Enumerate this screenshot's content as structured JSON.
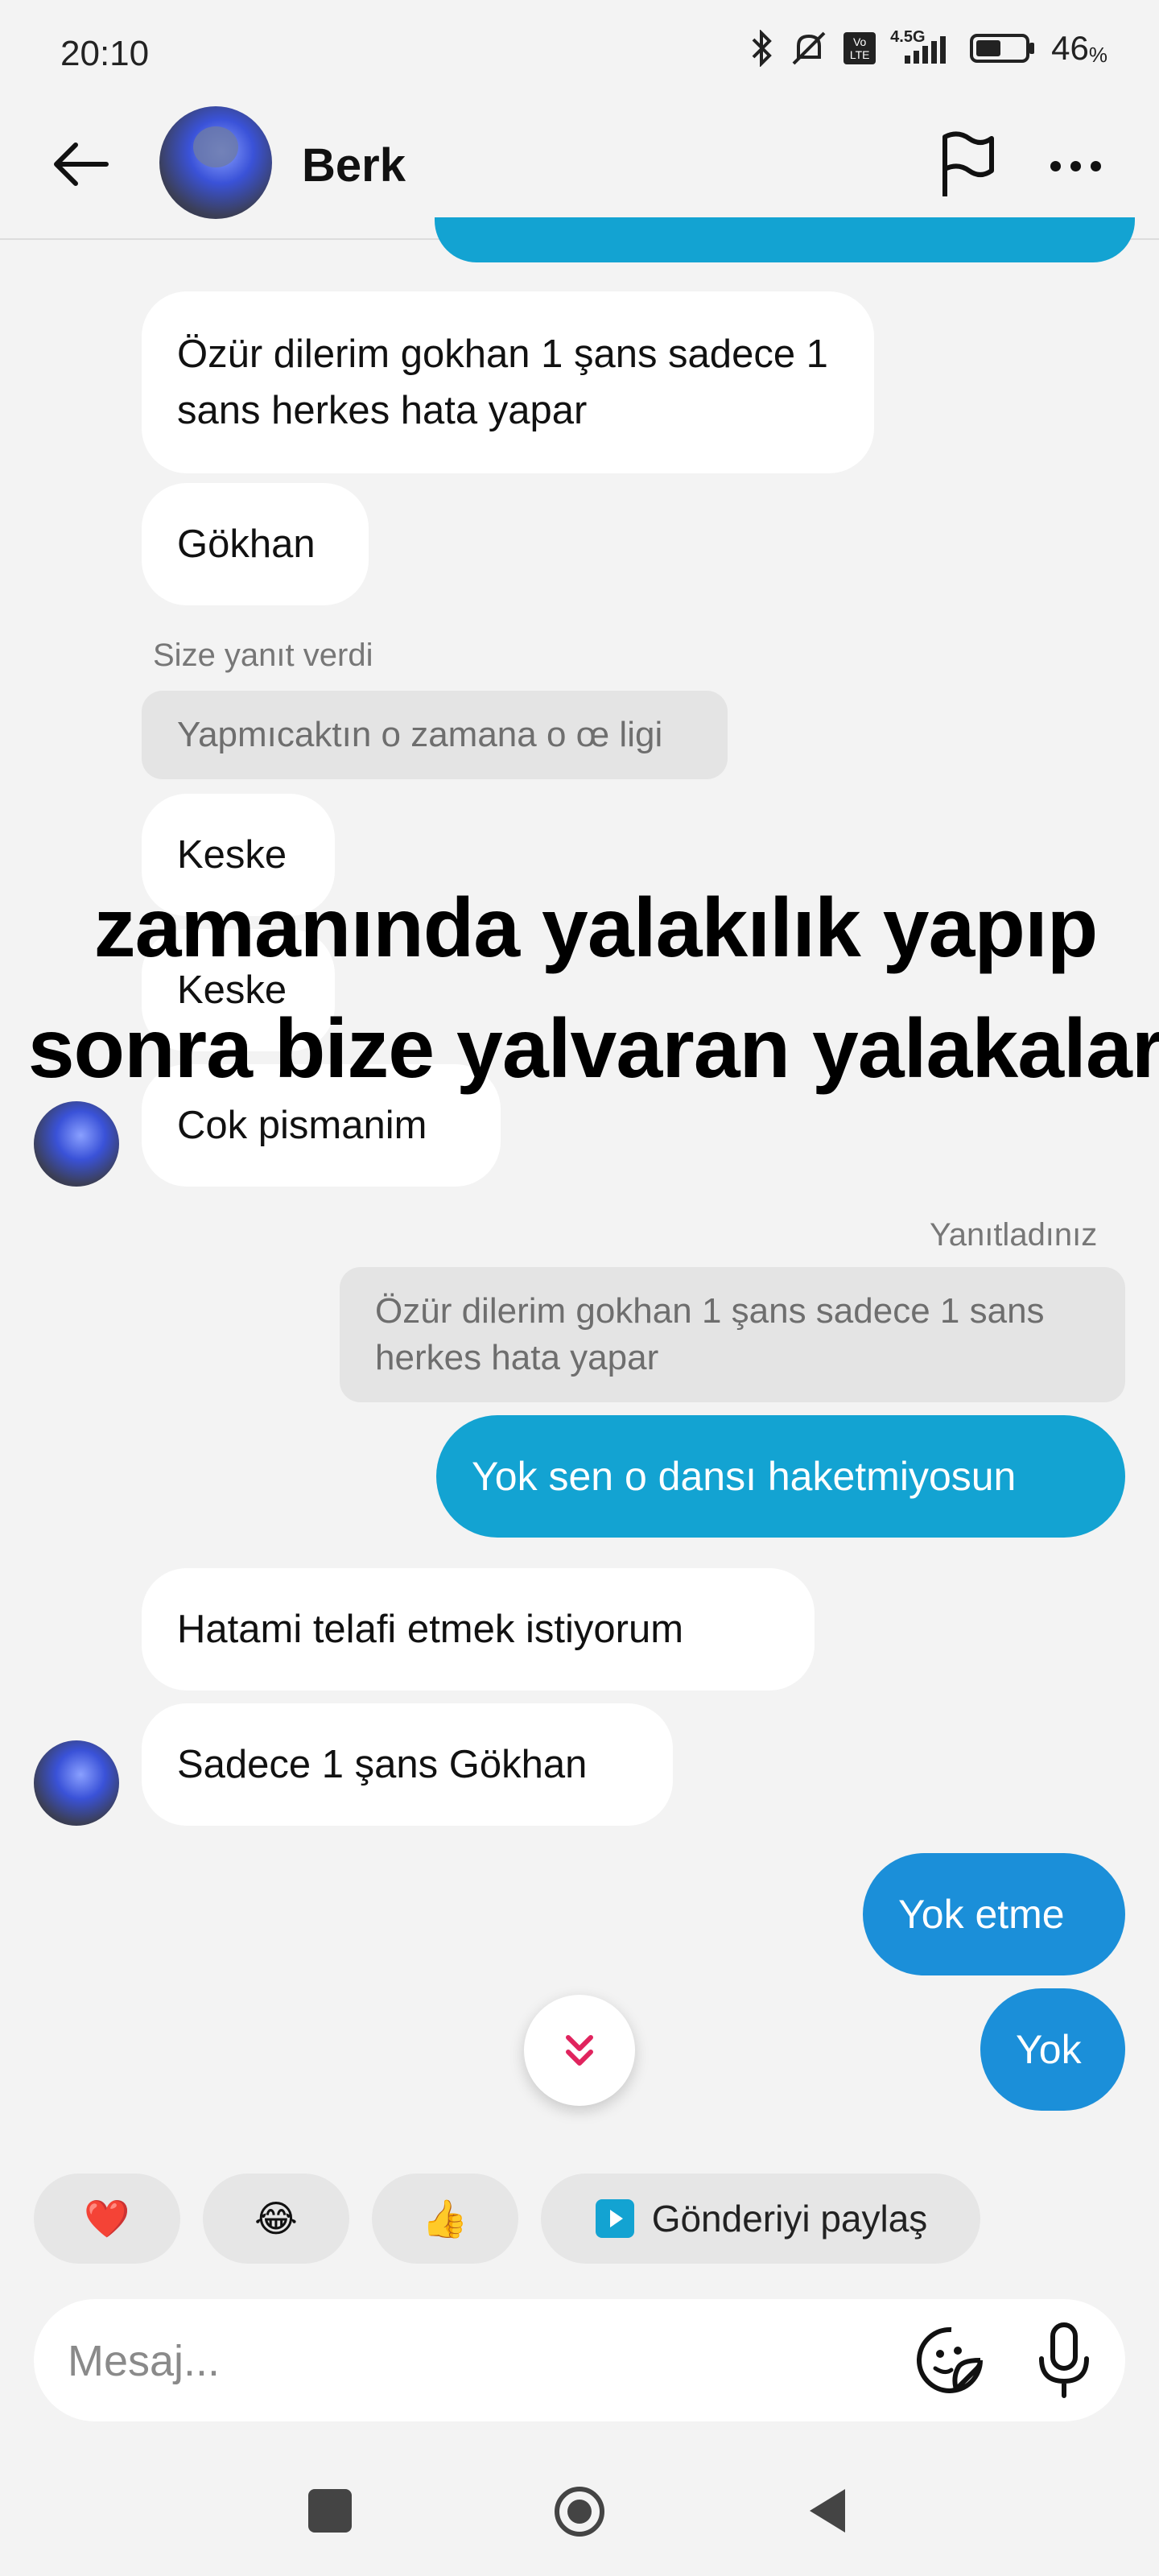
{
  "status_bar": {
    "time": "20:10",
    "network": "4.5G",
    "volte": "Vo LTE",
    "battery_percent": "46",
    "battery_percent_sign": "%"
  },
  "header": {
    "contact_name": "Berk"
  },
  "messages": {
    "in_1": "Özür dilerim gokhan 1 şans sadece 1 sans herkes hata yapar",
    "in_2": "Gökhan",
    "reply_meta_1": "Size yanıt verdi",
    "reply_quote_1": "Yapmıcaktın o zamana o œ ligi",
    "in_3": "Keske",
    "in_4": "Keske",
    "in_5": "Cok pismanim",
    "reply_meta_2": "Yanıtladınız",
    "reply_quote_2": "Özür dilerim gokhan 1 şans sadece 1 sans herkes hata yapar",
    "out_1": "Yok sen o dansı haketmiyosun",
    "in_6": "Hatami telafi etmek istiyorum",
    "in_7": "Sadece 1 şans Gökhan",
    "out_2": "Yok etme",
    "out_3": "Yok"
  },
  "overlay": {
    "line1": "zamanında yalakılık yapıp",
    "line2": "sonra bize yalvaran yalakalar"
  },
  "quick_actions": {
    "heart": "❤️",
    "laugh": "😂",
    "thumbs": "👍",
    "share_label": "Gönderiyi paylaş"
  },
  "composer": {
    "placeholder": "Mesaj..."
  },
  "colors": {
    "outgoing": "#13a3d2",
    "outgoing_alt": "#1b8fd9",
    "background": "#f3f3f3"
  }
}
